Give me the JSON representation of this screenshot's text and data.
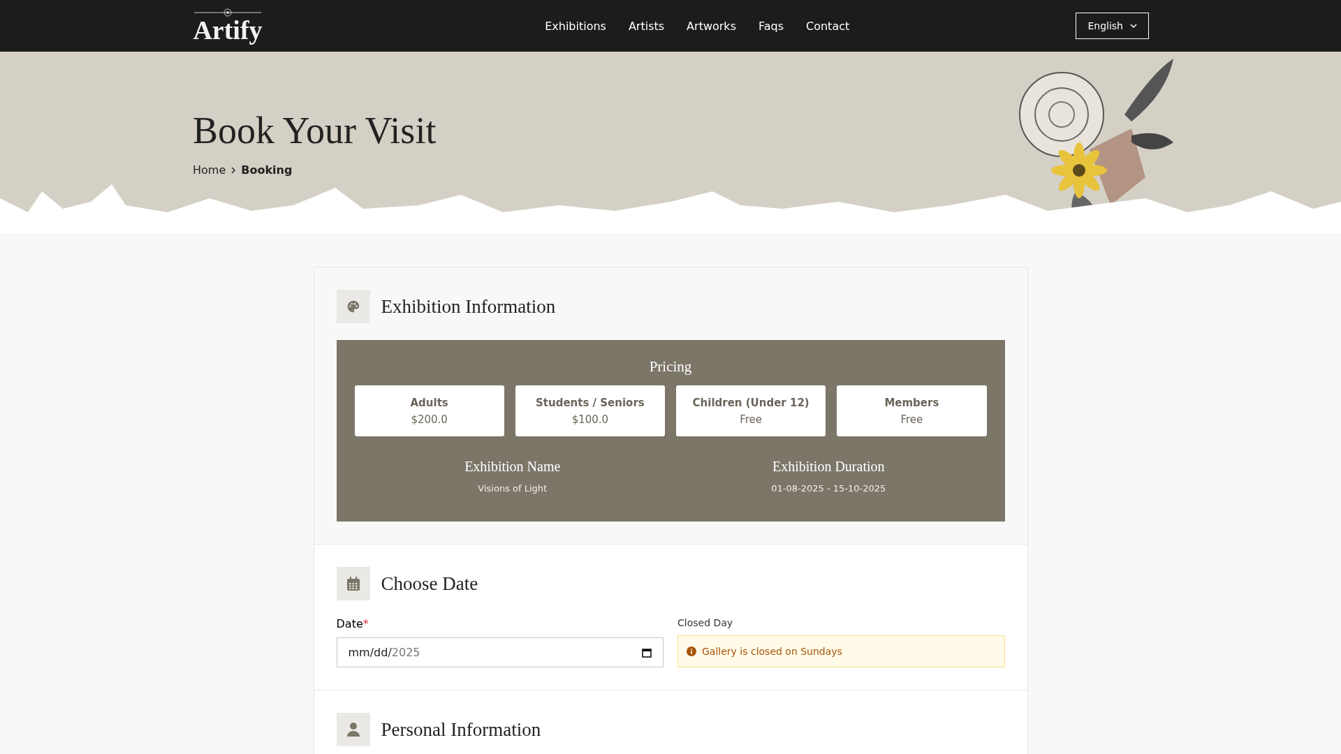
{
  "header": {
    "logo": "Artify",
    "nav": [
      {
        "label": "Exhibitions"
      },
      {
        "label": "Artists"
      },
      {
        "label": "Artworks"
      },
      {
        "label": "Faqs"
      },
      {
        "label": "Contact"
      }
    ],
    "language": "English"
  },
  "hero": {
    "title": "Book Your Visit",
    "breadcrumb": [
      {
        "label": "Home",
        "current": false
      },
      {
        "label": "Booking",
        "current": true
      }
    ]
  },
  "exhibition_section": {
    "title": "Exhibition Information",
    "pricing_title": "Pricing",
    "prices": [
      {
        "label": "Adults",
        "price": "$200.0"
      },
      {
        "label": "Students / Seniors",
        "price": "$100.0"
      },
      {
        "label": "Children (Under 12)",
        "price": "Free"
      },
      {
        "label": "Members",
        "price": "Free"
      }
    ],
    "details": [
      {
        "label": "Exhibition Name",
        "value": "Visions of Light"
      },
      {
        "label": "Exhibition Duration",
        "value": "01-08-2025 - 15-10-2025"
      }
    ]
  },
  "date_section": {
    "title": "Choose Date",
    "date_label": "Date",
    "required_mark": "*",
    "date_value": "mm/dd/",
    "date_year": "2025",
    "closed_label": "Closed Day",
    "closed_notice": "Gallery is closed on Sundays"
  },
  "personal_section": {
    "title": "Personal Information"
  }
}
